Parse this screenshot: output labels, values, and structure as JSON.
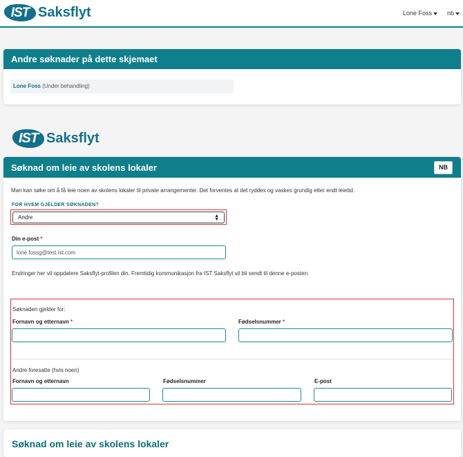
{
  "header": {
    "logo_mark": "IST",
    "logo_word": "Saksflyt",
    "user_name": "Lone Foss",
    "language": "nb"
  },
  "other_applications": {
    "title": "Andre søknader på dette skjemaet",
    "items": [
      {
        "name": "Lone Foss",
        "status": "(Under behandling)"
      }
    ]
  },
  "form_logo": {
    "mark": "IST",
    "word": "Saksflyt"
  },
  "form": {
    "title": "Søknad om leie av skolens lokaler",
    "lang_button": "NB",
    "intro": "Man kan søke om å få leie noen av skolens lokaler til private arrangementer. Det forventes at det ryddes og vaskes grundig etter endt leietid.",
    "for_whom_label": "FOR HVEM GJELDER SØKNADEN?",
    "for_whom_value": "Andre",
    "email_label": "Din e-post",
    "email_required": "*",
    "email_value": "lone.fossg@test.ist.com",
    "email_note": "Endringer her vil oppdatere Saksflyt-profilen din. Fremtidig kommunikasjon fra IST Saksflyt vil bli sendt til denne e-posten.",
    "applies_for_label": "Søknaden gjelder for:",
    "fullname_label": "Fornavn og etternavn",
    "birthnumber_label": "Fødselsnummer",
    "required_mark": "*",
    "guardians_label": "Andre foresatte (hvis noen)",
    "guardian_fullname_label": "Fornavn og etternavn",
    "guardian_birthnumber_label": "Fødselsnummer",
    "guardian_email_label": "E-post"
  },
  "bottom": {
    "title": "Søknad om leie av skolens lokaler"
  },
  "colors": {
    "brand": "#0f7f8c",
    "error_outline": "#d9303c"
  }
}
